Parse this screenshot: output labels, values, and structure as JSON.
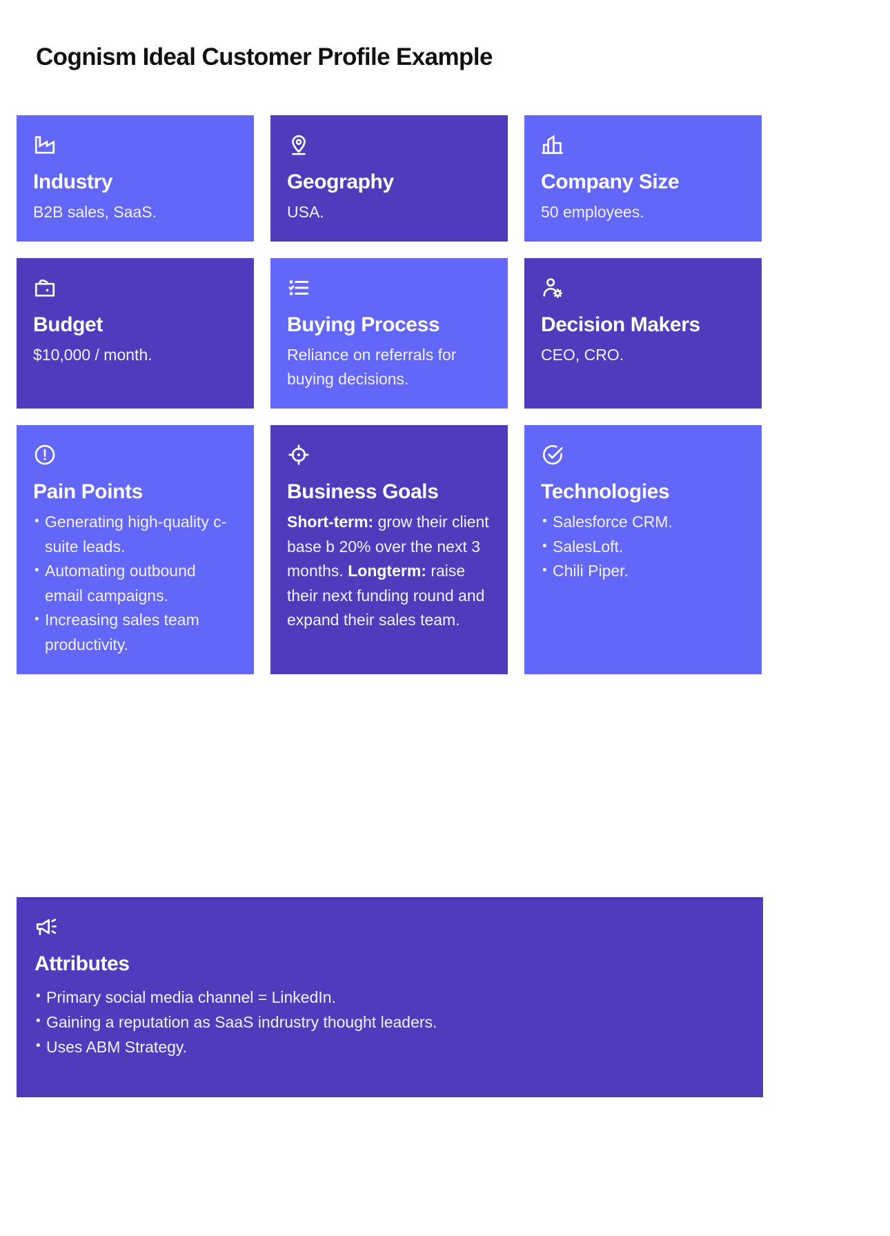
{
  "page": {
    "title": "Cognism Ideal Customer Profile Example",
    "background": "#ffffff",
    "colors": {
      "card_light": "#6266f9",
      "card_dark": "#4f3cbd",
      "title_text": "#111111",
      "card_text": "#ffffff"
    }
  },
  "cards": [
    {
      "icon": "factory-icon",
      "title": "Industry",
      "body": "B2B sales, SaaS.",
      "theme": "light"
    },
    {
      "icon": "map-pin-icon",
      "title": "Geography",
      "body": "USA.",
      "theme": "dark"
    },
    {
      "icon": "building-bars-icon",
      "title": "Company Size",
      "body": "50 employees.",
      "theme": "light"
    },
    {
      "icon": "wallet-icon",
      "title": "Budget",
      "body": "$10,000 / month.",
      "theme": "dark"
    },
    {
      "icon": "checklist-icon",
      "title": "Buying Process",
      "body": "Reliance on referrals for buying decisions.",
      "theme": "light"
    },
    {
      "icon": "user-gear-icon",
      "title": "Decision Makers",
      "body": "CEO, CRO.",
      "theme": "dark"
    }
  ],
  "pain_points": {
    "icon": "alert-circle-icon",
    "title": "Pain Points",
    "theme": "light",
    "bullets": [
      "Generating high-quality c-suite leads.",
      "Automating outbound email campaigns.",
      "Increasing sales team productivity."
    ]
  },
  "business_goals": {
    "icon": "crosshair-icon",
    "title": "Business Goals",
    "theme": "dark",
    "short_term_label": "Short-term:",
    "short_term_text": " grow their client base b 20% over the next 3 months. ",
    "long_term_label": "Longterm:",
    "long_term_text": " raise their next funding round and expand their sales team."
  },
  "technologies": {
    "icon": "check-circle-icon",
    "title": "Technologies",
    "theme": "light",
    "bullets": [
      "Salesforce CRM.",
      "SalesLoft.",
      "Chili Piper."
    ]
  },
  "attributes": {
    "icon": "megaphone-icon",
    "title": "Attributes",
    "theme": "dark",
    "bullets": [
      "Primary social media channel = LinkedIn.",
      "Gaining a reputation as SaaS indrustry thought leaders.",
      "Uses ABM Strategy."
    ]
  }
}
